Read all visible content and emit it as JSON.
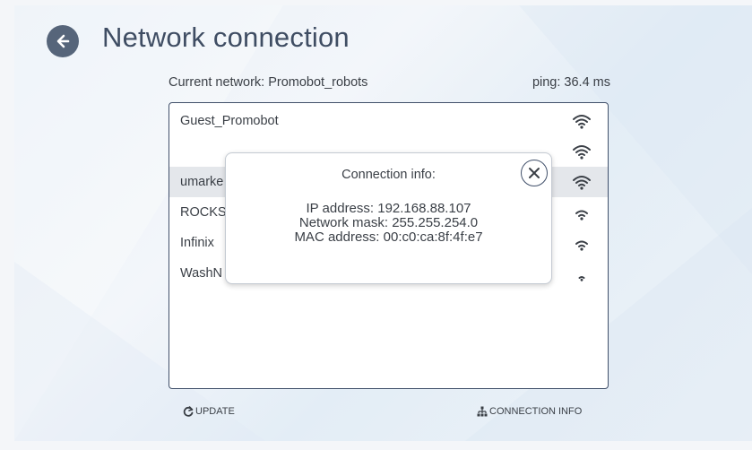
{
  "header": {
    "title": "Network connection"
  },
  "status": {
    "current_network": "Current network: Promobot_robots",
    "ping": "ping: 36.4 ms"
  },
  "networks": [
    {
      "name": "Guest_Promobot",
      "signal": 4
    },
    {
      "name": "",
      "signal": 4
    },
    {
      "name": "umarke",
      "signal": 4,
      "selected": true
    },
    {
      "name": "ROCKS",
      "signal": 3
    },
    {
      "name": "Infinix",
      "signal": 3
    },
    {
      "name": "WashN",
      "signal": 1
    }
  ],
  "dialog": {
    "title": "Connection info:",
    "ip": "IP address: 192.168.88.107",
    "mask": "Network mask: 255.255.254.0",
    "mac": "MAC address: 00:c0:ca:8f:4f:e7"
  },
  "footer": {
    "update_label": "UPDATE",
    "connection_info_label": "CONNECTION INFO"
  },
  "icons": {
    "back": "arrow-left-circle-icon",
    "close": "close-icon",
    "wifi": "wifi-icon",
    "refresh": "refresh-icon",
    "network": "network-tree-icon"
  },
  "colors": {
    "accent": "#56657a",
    "title": "#3f4d63",
    "list_border": "#41506a",
    "selected_row": "#e4e7eb"
  }
}
